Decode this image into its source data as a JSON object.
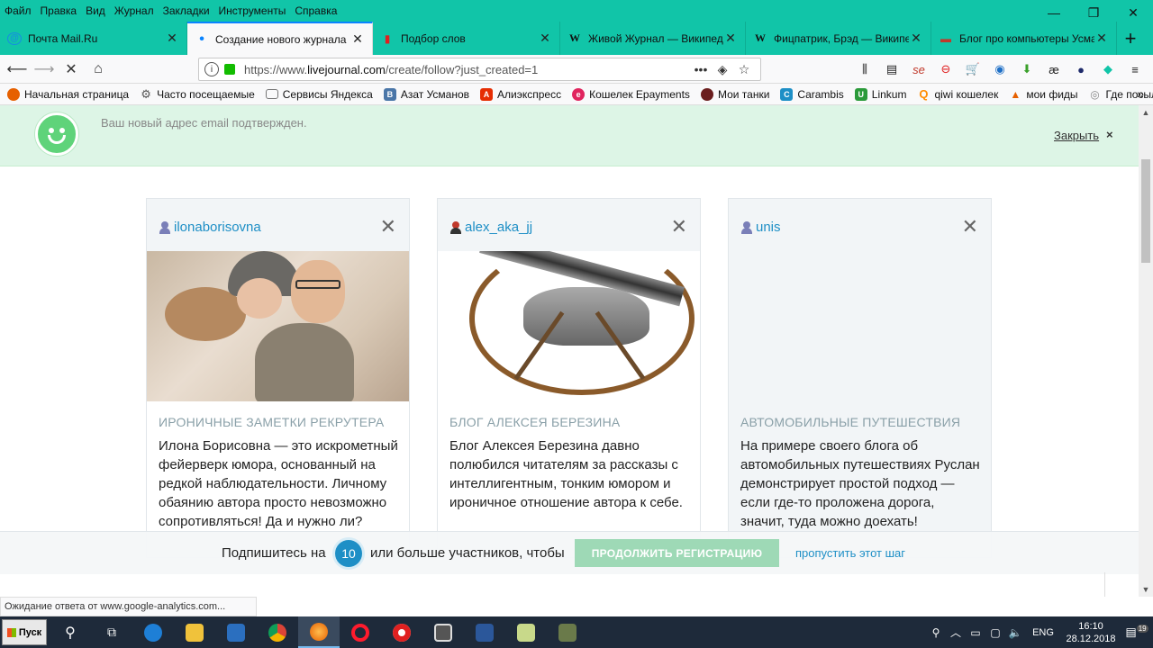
{
  "menu": [
    "Файл",
    "Правка",
    "Вид",
    "Журнал",
    "Закладки",
    "Инструменты",
    "Справка"
  ],
  "tabs": [
    {
      "title": "Почта Mail.Ru",
      "icon": "mail-icon",
      "color": "#168de2",
      "glyph": "@"
    },
    {
      "title": "Создание нового журнала",
      "icon": "loading-dot-icon",
      "color": "#0a84ff",
      "glyph": "•",
      "active": true
    },
    {
      "title": "Подбор слов",
      "icon": "chart-icon",
      "color": "#e02020",
      "glyph": "▮"
    },
    {
      "title": "Живой Журнал — Википедия",
      "icon": "wikipedia-icon",
      "color": "#000000",
      "glyph": "W"
    },
    {
      "title": "Фицпатрик, Брэд — Википедия",
      "icon": "wikipedia-icon",
      "color": "#000000",
      "glyph": "W"
    },
    {
      "title": "Блог про компьютеры Усма",
      "icon": "blog-icon",
      "color": "#c0392b",
      "glyph": "▬"
    }
  ],
  "navbar": {
    "url_prefix": "https://www.",
    "url_host": "livejournal.com",
    "url_path": "/create/follow?just_created=1"
  },
  "bookmarks": [
    {
      "label": "Начальная страница",
      "color": "#e66000",
      "glyph": "●"
    },
    {
      "label": "Часто посещаемые",
      "color": "#555555",
      "glyph": "⚙"
    },
    {
      "label": "Сервисы Яндекса",
      "color": "#777777",
      "glyph": "▭"
    },
    {
      "label": "Азат Усманов",
      "color": "#4a76a8",
      "glyph": "В"
    },
    {
      "label": "Алиэкспресс",
      "color": "#e62e04",
      "glyph": "Ⓐ"
    },
    {
      "label": "Кошелек Epayments",
      "color": "#e0245e",
      "glyph": "e"
    },
    {
      "label": "Мои танки",
      "color": "#6b1e1e",
      "glyph": "●"
    },
    {
      "label": "Carambis",
      "color": "#1e8fc6",
      "glyph": "C"
    },
    {
      "label": "Linkum",
      "color": "#2b9a3a",
      "glyph": "U"
    },
    {
      "label": "qiwi кошелек",
      "color": "#ff8c00",
      "glyph": "Q"
    },
    {
      "label": "мои фиды",
      "color": "#e66000",
      "glyph": "▲"
    },
    {
      "label": "Где посылка?",
      "color": "#888888",
      "glyph": "◎"
    }
  ],
  "notice": {
    "message": "Ваш новый адрес email подтвержден.",
    "close_label": "Закрыть",
    "close_glyph": "×"
  },
  "cards": [
    {
      "username": "ilonaborisovna",
      "category": "ИРОНИЧНЫЕ ЗАМЕТКИ РЕКРУТЕРА",
      "description": "Илона Борисовна — это искрометный фейерверк юмора, основанный на редкой наблюдательности. Личному обаянию автора просто невозможно сопротивляться! Да и нужно ли?",
      "user_icon_color": "#7a7fb8"
    },
    {
      "username": "alex_aka_jj",
      "category": "БЛОГ АЛЕКСЕЯ БЕРЕЗИНА",
      "description": "Блог Алексея Березина давно полюбился читателям за рассказы с интеллигентным, тонким юмором и ироничное отношение автора к себе.",
      "user_icon_color": "#c0392b"
    },
    {
      "username": "unis",
      "category": "АВТОМОБИЛЬНЫЕ ПУТЕШЕСТВИЯ",
      "description": "На примере своего блога об автомобильных путешествиях Руслан демонстрирует простой подход — если где-то проложена дорога, значит, туда можно доехать!",
      "user_icon_color": "#7a7fb8"
    }
  ],
  "subscribe": {
    "before": "Подпишитесь на",
    "count": "10",
    "after": "или больше участников, чтобы",
    "continue_label": "ПРОДОЛЖИТЬ РЕГИСТРАЦИЮ",
    "skip_label": "пропустить этот шаг"
  },
  "status": "Ожидание ответа от www.google-analytics.com...",
  "taskbar": {
    "start_label": "Пуск",
    "lang": "ENG",
    "time": "16:10",
    "date": "28.12.2018",
    "notif_count": "19"
  },
  "colors": {
    "accent": "#11c5a8",
    "link": "#1e8fc6",
    "notice_bg": "#ddf5e6",
    "button": "#9ed9b6"
  }
}
